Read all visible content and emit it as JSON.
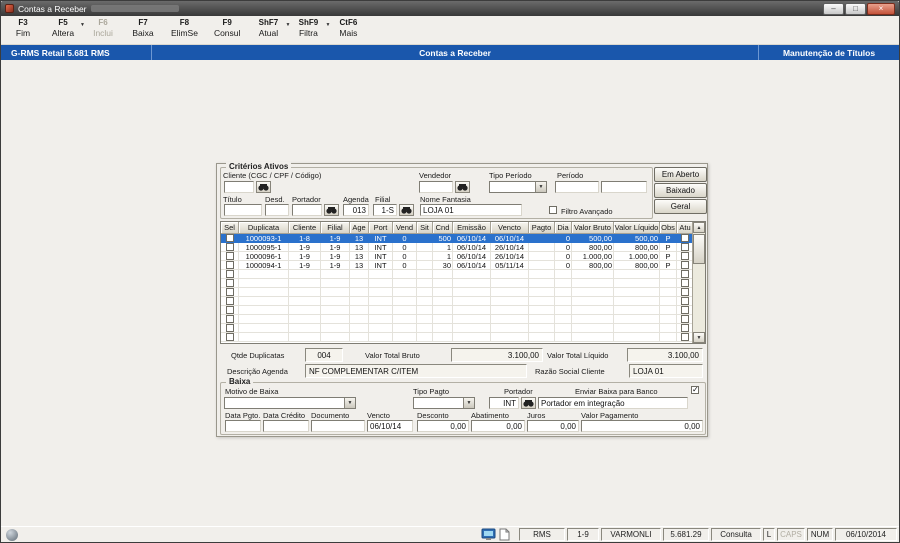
{
  "window": {
    "title": "Contas a Receber",
    "minimize": "–",
    "maximize": "□",
    "close": "×"
  },
  "header": {
    "product": "G-RMS Retail 5.681 RMS",
    "screen": "Contas a Receber",
    "section": "Manutenção de Títulos"
  },
  "toolbar": {
    "items": [
      {
        "key": "F3",
        "label": "Fim",
        "enabled": true,
        "arrow": false
      },
      {
        "key": "F5",
        "label": "Altera",
        "enabled": true,
        "arrow": true
      },
      {
        "key": "F6",
        "label": "Inclui",
        "enabled": false,
        "arrow": false
      },
      {
        "key": "F7",
        "label": "Baixa",
        "enabled": true,
        "arrow": false
      },
      {
        "key": "F8",
        "label": "ElimSe",
        "enabled": true,
        "arrow": false
      },
      {
        "key": "F9",
        "label": "Consul",
        "enabled": true,
        "arrow": false
      },
      {
        "key": "ShF7",
        "label": "Atual",
        "enabled": true,
        "arrow": true
      },
      {
        "key": "ShF9",
        "label": "Filtra",
        "enabled": true,
        "arrow": true
      },
      {
        "key": "CtF6",
        "label": "Mais",
        "enabled": true,
        "arrow": false
      }
    ]
  },
  "criteria": {
    "group_title": "Critérios Ativos",
    "cliente_label": "Cliente (CGC / CPF / Código)",
    "cliente_value": "",
    "vendedor_label": "Vendedor",
    "vendedor_value": "",
    "tipo_periodo_label": "Tipo Período",
    "tipo_periodo_value": "",
    "periodo_label": "Período",
    "periodo_de": "",
    "periodo_ate": "",
    "titulo_label": "Título",
    "titulo_value": "",
    "desd_label": "Desd.",
    "desd_value": "",
    "portador_label": "Portador",
    "portador_value": "",
    "agenda_label": "Agenda",
    "agenda_value": "013",
    "filial_label": "Filial",
    "filial_value": "1-S",
    "nome_fantasia_label": "Nome Fantasia",
    "nome_fantasia_value": "LOJA 01",
    "filtro_avancado_label": "Filtro Avançado",
    "filtro_avancado_checked": false,
    "side_buttons": [
      "Em Aberto",
      "Baixado",
      "Geral"
    ]
  },
  "grid": {
    "columns": [
      "Sel",
      "Duplicata",
      "Cliente",
      "Filial",
      "Age",
      "Port",
      "Vend",
      "Sit",
      "Cnd",
      "Emissão",
      "Vencto",
      "Pagto",
      "Dia",
      "Valor Bruto",
      "Valor Líquido",
      "Obs",
      "Atu"
    ],
    "rows": [
      {
        "selected": true,
        "duplicata": "1000093-1",
        "cliente": "1-8",
        "filial": "1-9",
        "age": "13",
        "port": "INT",
        "vend": "0",
        "sit": "",
        "cnd": "500",
        "emissao": "06/10/14",
        "vencto": "06/10/14",
        "pagto": "",
        "dia": "0",
        "valor_bruto": "500,00",
        "valor_liquido": "500,00",
        "obs": "P"
      },
      {
        "selected": false,
        "duplicata": "1000095-1",
        "cliente": "1-9",
        "filial": "1-9",
        "age": "13",
        "port": "INT",
        "vend": "0",
        "sit": "",
        "cnd": "1",
        "emissao": "06/10/14",
        "vencto": "26/10/14",
        "pagto": "",
        "dia": "0",
        "valor_bruto": "800,00",
        "valor_liquido": "800,00",
        "obs": "P"
      },
      {
        "selected": false,
        "duplicata": "1000096-1",
        "cliente": "1-9",
        "filial": "1-9",
        "age": "13",
        "port": "INT",
        "vend": "0",
        "sit": "",
        "cnd": "1",
        "emissao": "06/10/14",
        "vencto": "26/10/14",
        "pagto": "",
        "dia": "0",
        "valor_bruto": "1.000,00",
        "valor_liquido": "1.000,00",
        "obs": "P"
      },
      {
        "selected": false,
        "duplicata": "1000094-1",
        "cliente": "1-9",
        "filial": "1-9",
        "age": "13",
        "port": "INT",
        "vend": "0",
        "sit": "",
        "cnd": "30",
        "emissao": "06/10/14",
        "vencto": "05/11/14",
        "pagto": "",
        "dia": "0",
        "valor_bruto": "800,00",
        "valor_liquido": "800,00",
        "obs": "P"
      }
    ],
    "empty_rows": 8
  },
  "totals": {
    "qtde_label": "Qtde Duplicatas",
    "qtde_value": "004",
    "bruto_label": "Valor Total Bruto",
    "bruto_value": "3.100,00",
    "liquido_label": "Valor Total Líquido",
    "liquido_value": "3.100,00",
    "descricao_agenda_label": "Descrição Agenda",
    "descricao_agenda_value": "NF COMPLEMENTAR C/ITEM",
    "razao_social_label": "Razão Social Cliente",
    "razao_social_value": "LOJA 01"
  },
  "baixa": {
    "group_title": "Baixa",
    "motivo_label": "Motivo de Baixa",
    "motivo_value": "",
    "tipo_pagto_label": "Tipo Pagto",
    "tipo_pagto_value": "",
    "portador_label": "Portador",
    "portador_value": "INT",
    "portador_info": "Portador em integração",
    "enviar_banco_label": "Enviar Baixa para Banco",
    "enviar_banco_checked": true,
    "fields": [
      {
        "label": "Data Pgto.",
        "value": "",
        "align": "left"
      },
      {
        "label": "Data Crédito",
        "value": "",
        "align": "left"
      },
      {
        "label": "Documento",
        "value": "",
        "align": "left"
      },
      {
        "label": "Vencto",
        "value": "06/10/14",
        "align": "left"
      },
      {
        "label": "Desconto",
        "value": "0,00",
        "align": "right"
      },
      {
        "label": "Abatimento",
        "value": "0,00",
        "align": "right"
      },
      {
        "label": "Juros",
        "value": "0,00",
        "align": "right"
      },
      {
        "label": "Valor Pagamento",
        "value": "0,00",
        "align": "right"
      }
    ]
  },
  "statusbar": {
    "cells": [
      "RMS",
      "1-9",
      "VARMONLI",
      "5.681.29",
      "Consulta",
      "L",
      "CAPS",
      "NUM",
      "06/10/2014"
    ],
    "dimmed": [
      "CAPS"
    ]
  },
  "colors": {
    "header_blue": "#1a57ac",
    "selected_row": "#2a71cc"
  }
}
